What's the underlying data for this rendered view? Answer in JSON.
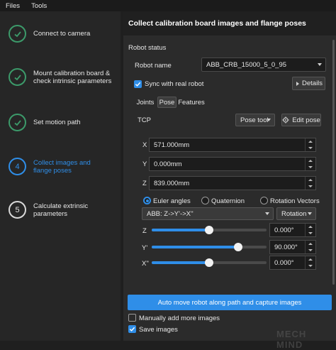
{
  "menu": {
    "items": [
      "Files",
      "Tools"
    ]
  },
  "steps": [
    {
      "label": "Connect to camera",
      "state": "done"
    },
    {
      "label": "Mount calibration board & check intrinsic parameters",
      "state": "done"
    },
    {
      "label": "Set motion path",
      "state": "done"
    },
    {
      "label": "Collect images and flange poses",
      "state": "active",
      "number": "4"
    },
    {
      "label": "Calculate extrinsic parameters",
      "state": "todo",
      "number": "5"
    }
  ],
  "panel": {
    "title": "Collect calibration board images and flange poses",
    "robot_status_label": "Robot status",
    "robot_name_label": "Robot name",
    "robot_name_value": "ABB_CRB_15000_5_0_95",
    "sync_label": "Sync with real robot",
    "sync_checked": true,
    "details_button": "Details",
    "tabs": [
      {
        "label": "Joints",
        "selected": false
      },
      {
        "label": "Pose",
        "selected": true
      },
      {
        "label": "Features",
        "selected": false
      }
    ],
    "tcp_label": "TCP",
    "pose_tool_label": "Pose tool",
    "edit_pose_button": "Edit pose",
    "position": [
      {
        "axis": "X",
        "value": "571.000mm"
      },
      {
        "axis": "Y",
        "value": "0.000mm"
      },
      {
        "axis": "Z",
        "value": "839.000mm"
      }
    ],
    "rotation_modes": [
      {
        "label": "Euler angles",
        "selected": true
      },
      {
        "label": "Quaternion",
        "selected": false
      },
      {
        "label": "Rotation Vectors",
        "selected": false
      }
    ],
    "euler_convention": "ABB: Z->Y'->X''",
    "rotation_button": "Rotation",
    "angles": [
      {
        "axis": "Z",
        "value": "0.000°",
        "level": 0.5
      },
      {
        "axis": "Y'",
        "value": "90.000°",
        "level": 0.75
      },
      {
        "axis": "X''",
        "value": "0.000°",
        "level": 0.5
      }
    ],
    "primary_button": "Auto move robot along path and capture images",
    "manual_label": "Manually add more images",
    "manual_checked": false,
    "save_label": "Save images",
    "save_checked": true
  },
  "watermark": "MECH MIND",
  "colors": {
    "accent": "#2f8ee8",
    "done": "#3c9a6a",
    "panel": "#2b2b2b"
  }
}
